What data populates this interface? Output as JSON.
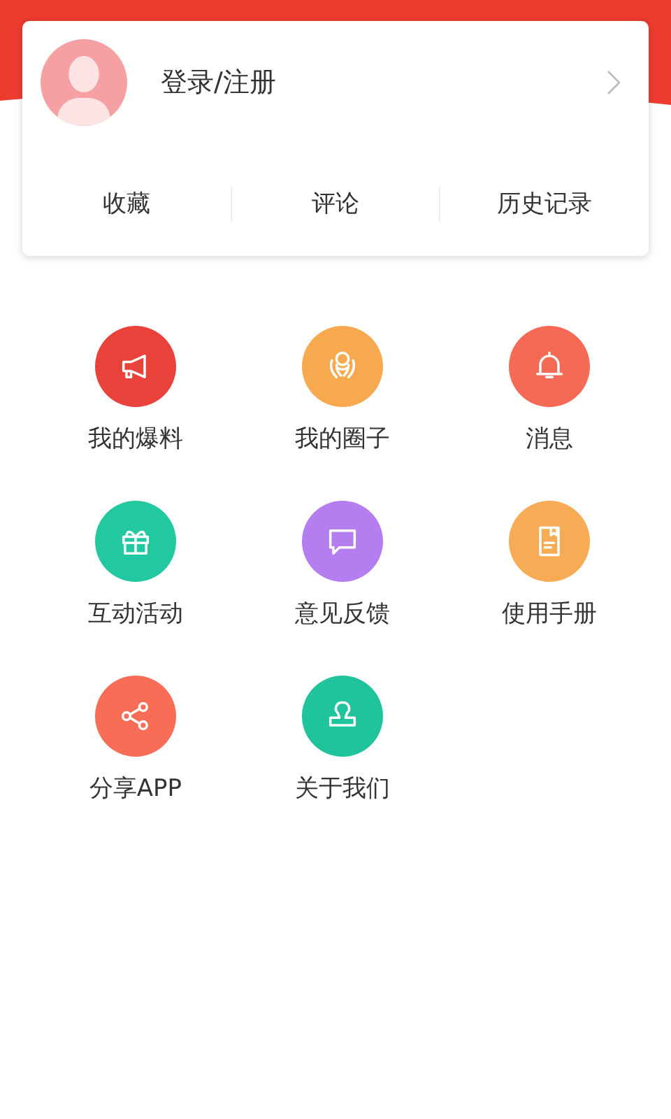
{
  "profile": {
    "login_label": "登录/注册"
  },
  "stats": [
    {
      "label": "收藏"
    },
    {
      "label": "评论"
    },
    {
      "label": "历史记录"
    }
  ],
  "menu": [
    {
      "label": "我的爆料",
      "color": "#e8423a"
    },
    {
      "label": "我的圈子",
      "color": "#f7a94f"
    },
    {
      "label": "消息",
      "color": "#f56a55"
    },
    {
      "label": "互动活动",
      "color": "#22c9a0"
    },
    {
      "label": "意见反馈",
      "color": "#b57ef0"
    },
    {
      "label": "使用手册",
      "color": "#f8ab55"
    },
    {
      "label": "分享APP",
      "color": "#f86d55"
    },
    {
      "label": "关于我们",
      "color": "#20c49c"
    }
  ]
}
